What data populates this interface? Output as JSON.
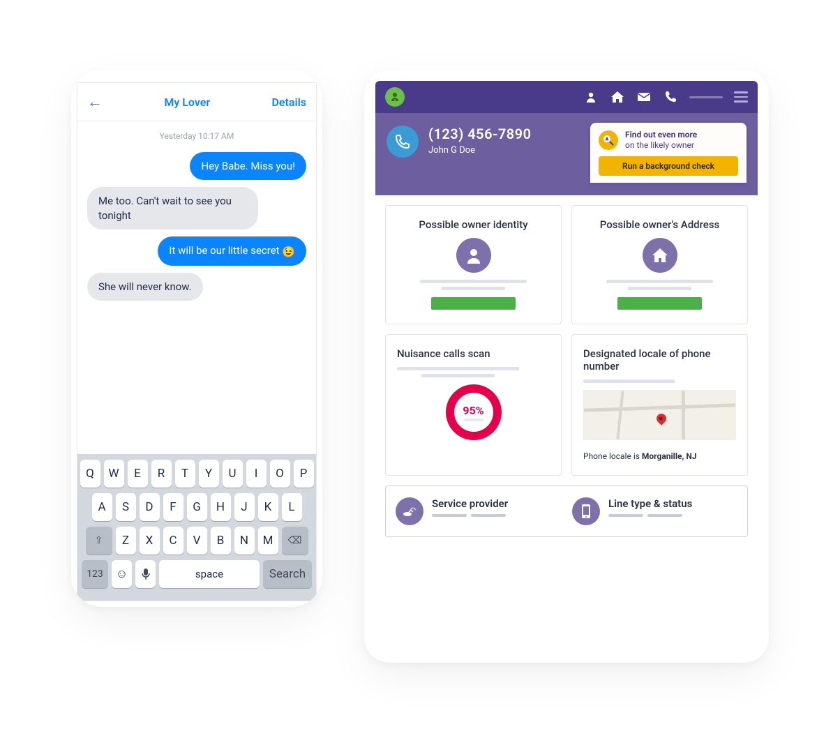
{
  "phone": {
    "chat_header": {
      "back": "←",
      "title": "My Lover",
      "details": "Details"
    },
    "timestamp": "Yesterday 10:17 AM",
    "messages": [
      {
        "text": "Hey Babe. Miss you!",
        "sent": true
      },
      {
        "text": "Me too. Can't wait to see you tonight",
        "sent": false
      },
      {
        "text": "It will be our little secret",
        "sent": true,
        "emoji": "😉"
      },
      {
        "text": "She will never know.",
        "sent": false
      }
    ],
    "keyboard": {
      "row1": [
        "Q",
        "W",
        "E",
        "R",
        "T",
        "Y",
        "U",
        "I",
        "O",
        "P"
      ],
      "row2": [
        "A",
        "S",
        "D",
        "F",
        "G",
        "H",
        "J",
        "K",
        "L"
      ],
      "row3": [
        "Z",
        "X",
        "C",
        "V",
        "B",
        "N",
        "M"
      ],
      "shift": "⇧",
      "backspace": "⌫",
      "num": "123",
      "emoji": "☺",
      "mic": "🎤",
      "space": "space",
      "search": "Search"
    }
  },
  "tablet": {
    "profile": {
      "phone": "(123) 456-7890",
      "name": "John G Doe"
    },
    "promo": {
      "line1": "Find out even more",
      "line2": "on the likely owner",
      "button": "Run a background check"
    },
    "cards": {
      "identity": {
        "title": "Possible owner identity"
      },
      "address": {
        "title": "Possible owner's Address"
      },
      "nuisance": {
        "title": "Nuisance calls scan",
        "value": "95%"
      },
      "locale": {
        "title": "Designated locale of phone number",
        "caption_prefix": "Phone locale is ",
        "caption_bold": "Morganille, NJ"
      }
    },
    "bottom": {
      "service": "Service provider",
      "line": "Line type & status"
    }
  }
}
